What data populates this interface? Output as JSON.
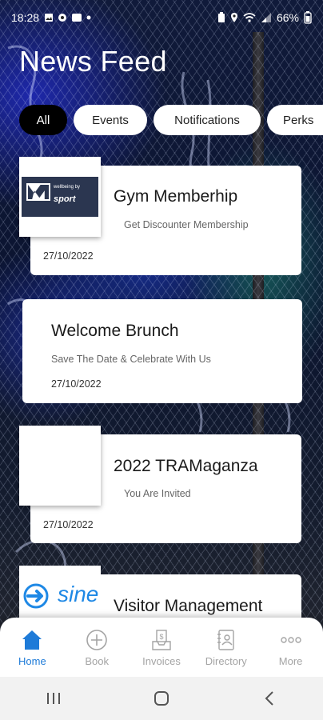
{
  "status": {
    "time": "18:28",
    "battery": "66%"
  },
  "page": {
    "title": "News Feed"
  },
  "filters": [
    {
      "label": "All",
      "active": true
    },
    {
      "label": "Events",
      "active": false
    },
    {
      "label": "Notifications",
      "active": false
    },
    {
      "label": "Perks",
      "active": false
    }
  ],
  "cards": [
    {
      "title": "Gym Memberhip",
      "subtitle": "Get Discounter Membership",
      "date": "27/10/2022",
      "thumb_logo_lines": [
        "wellbeing by",
        "sport"
      ]
    },
    {
      "title": "Welcome Brunch",
      "subtitle": "Save The Date  &  Celebrate With Us",
      "date": "27/10/2022"
    },
    {
      "title": "2022 TRAMaganza",
      "subtitle": "You Are Invited",
      "date": "27/10/2022"
    },
    {
      "title": "Visitor Management",
      "thumb_logo": "sine"
    }
  ],
  "bottom_nav": [
    {
      "label": "Home",
      "icon": "home-icon",
      "active": true
    },
    {
      "label": "Book",
      "icon": "plus-circle-icon",
      "active": false
    },
    {
      "label": "Invoices",
      "icon": "invoice-tray-icon",
      "active": false
    },
    {
      "label": "Directory",
      "icon": "directory-book-icon",
      "active": false
    },
    {
      "label": "More",
      "icon": "more-dots-icon",
      "active": false
    }
  ],
  "colors": {
    "accent": "#1e7bd8",
    "inactive": "#a4a4a4",
    "chip_active_bg": "#000000"
  }
}
